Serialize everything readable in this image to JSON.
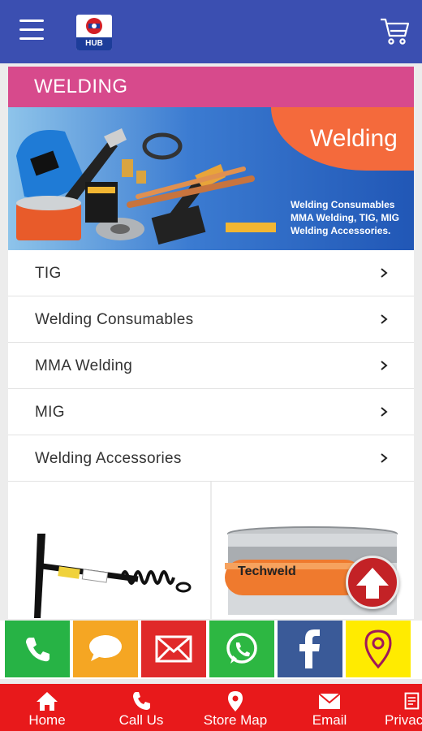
{
  "header": {
    "logo_text": "HUB",
    "icons": {
      "menu": "hamburger-icon",
      "cart": "cart-icon"
    }
  },
  "category": {
    "title": "WELDING"
  },
  "banner": {
    "headline": "Welding",
    "subtext_lines": [
      "Welding Consumables",
      "MMA Welding, TIG, MIG",
      "Welding Accessories."
    ]
  },
  "subcategories": [
    {
      "label": "TIG"
    },
    {
      "label": "Welding Consumables"
    },
    {
      "label": "MMA Welding"
    },
    {
      "label": "MIG"
    },
    {
      "label": "Welding Accessories"
    }
  ],
  "products": [
    {
      "image": "chipping-hammer"
    },
    {
      "image": "welding-wire-spool",
      "brand_text": "Techweld"
    }
  ],
  "share_bar": [
    {
      "name": "call",
      "icon": "phone-icon",
      "color": "#27b345"
    },
    {
      "name": "sms",
      "icon": "chat-icon",
      "color": "#f5a623"
    },
    {
      "name": "email",
      "icon": "mail-icon",
      "color": "#e02929"
    },
    {
      "name": "whatsapp",
      "icon": "whatsapp-icon",
      "color": "#2db742"
    },
    {
      "name": "facebook",
      "icon": "facebook-icon",
      "color": "#3a5a98"
    },
    {
      "name": "location",
      "icon": "map-pin-icon",
      "color": "#ffeb00"
    }
  ],
  "bottom_nav": [
    {
      "label": "Home",
      "icon": "home-icon"
    },
    {
      "label": "Call Us",
      "icon": "phone-icon"
    },
    {
      "label": "Store Map",
      "icon": "map-pin-icon"
    },
    {
      "label": "Email",
      "icon": "mail-icon"
    },
    {
      "label": "Privacy",
      "icon": "document-icon"
    }
  ],
  "colors": {
    "header": "#3b4fb1",
    "category_title": "#d74a8c",
    "bottom_nav": "#e8191b",
    "scroll_top": "#c32226"
  }
}
